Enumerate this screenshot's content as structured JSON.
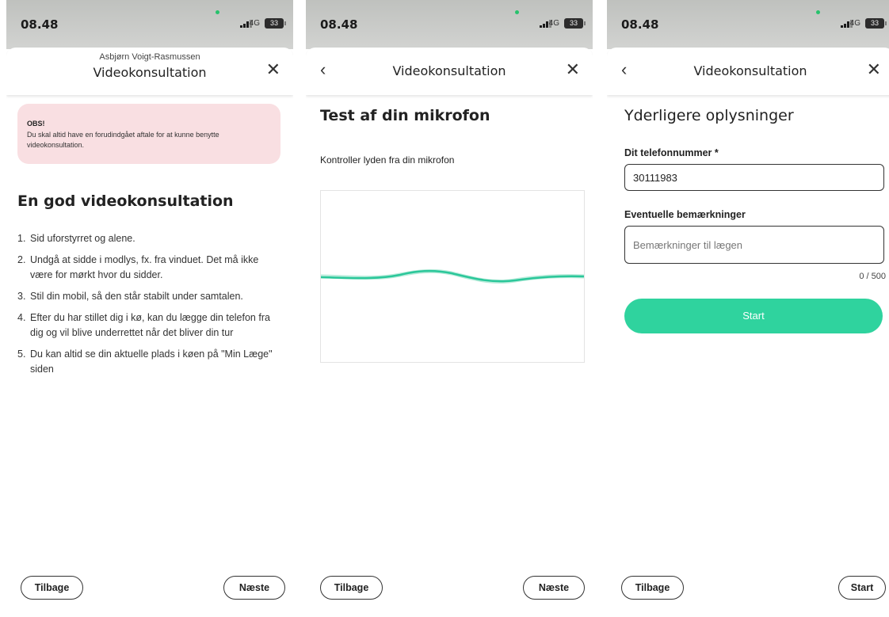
{
  "status": {
    "time": "08.48",
    "network": "4G",
    "battery": "33"
  },
  "screen1": {
    "header_subtitle": "Asbjørn Voigt-Rasmussen",
    "header_title": "Videokonsultation",
    "obs_title": "OBS!",
    "obs_text": "Du skal altid have en forudindgået aftale for at kunne benytte videokonsultation.",
    "heading": "En god videokonsultation",
    "tips": [
      {
        "num": "1.",
        "text": "Sid uforstyrret og alene."
      },
      {
        "num": "2.",
        "text": "Undgå at sidde i modlys, fx. fra vinduet. Det må ikke være for mørkt hvor du sidder."
      },
      {
        "num": "3.",
        "text": "Stil din mobil, så den står stabilt under samtalen."
      },
      {
        "num": "4.",
        "text": "Efter du har stillet dig i kø, kan du lægge din telefon fra dig og vil blive underrettet når det bliver din tur"
      },
      {
        "num": "5.",
        "text": "Du kan altid se din aktuelle plads i køen på \"Min Læge\" siden"
      }
    ],
    "back_label": "Tilbage",
    "next_label": "Næste"
  },
  "screen2": {
    "header_title": "Videokonsultation",
    "heading": "Test af din mikrofon",
    "instruction": "Kontroller lyden fra din mikrofon",
    "back_label": "Tilbage",
    "next_label": "Næste"
  },
  "screen3": {
    "header_title": "Videokonsultation",
    "heading": "Yderligere oplysninger",
    "phone_label": "Dit telefonnummer *",
    "phone_value": "30111983",
    "remarks_label": "Eventuelle bemærkninger",
    "remarks_placeholder": "Bemærkninger til lægen",
    "counter": "0 / 500",
    "start_big_label": "Start",
    "back_label": "Tilbage",
    "start_label": "Start"
  },
  "colors": {
    "accent": "#2fd39e",
    "wave": "#2bc79a",
    "obs_bg": "#f9dfe2"
  }
}
